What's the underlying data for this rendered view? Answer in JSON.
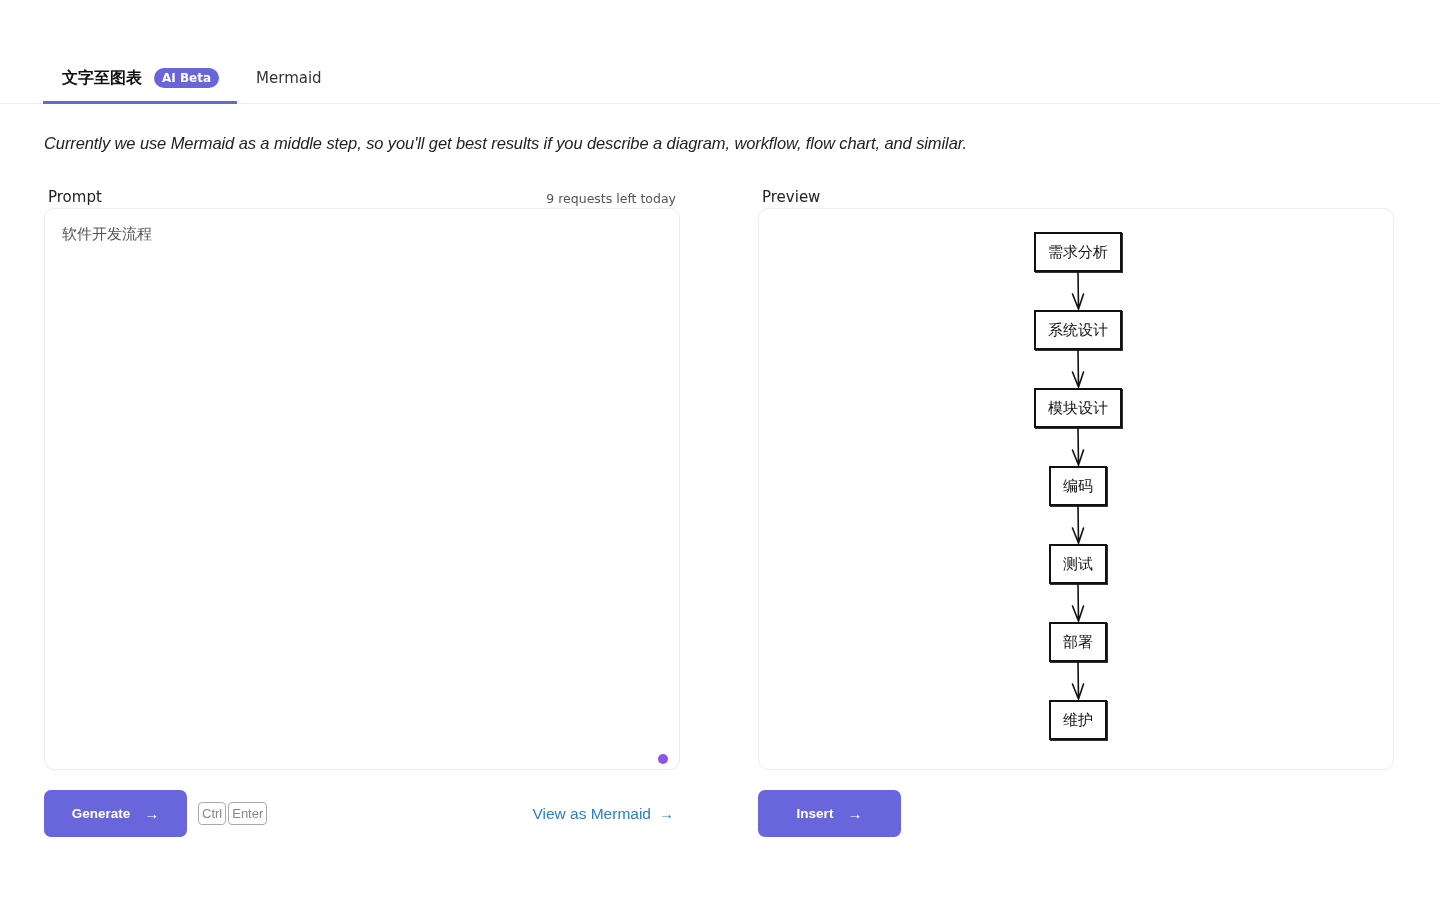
{
  "tabs": [
    {
      "label": "文字至图表",
      "badge": "AI Beta",
      "selected": true
    },
    {
      "label": "Mermaid",
      "selected": false
    }
  ],
  "description": "Currently we use Mermaid as a middle step, so you'll get best results if you describe a diagram, workflow, flow chart, and similar.",
  "prompt": {
    "label": "Prompt",
    "quota": "9 requests left today",
    "value": "软件开发流程"
  },
  "generate_button": {
    "label": "Generate",
    "arrow": "→"
  },
  "shortcut": [
    "Ctrl",
    "Enter"
  ],
  "view_link": {
    "label": "View as Mermaid",
    "arrow": "→"
  },
  "preview": {
    "label": "Preview",
    "nodes": [
      "需求分析",
      "系统设计",
      "模块设计",
      "编码",
      "测试",
      "部署",
      "维护"
    ]
  },
  "insert_button": {
    "label": "Insert",
    "arrow": "→"
  }
}
